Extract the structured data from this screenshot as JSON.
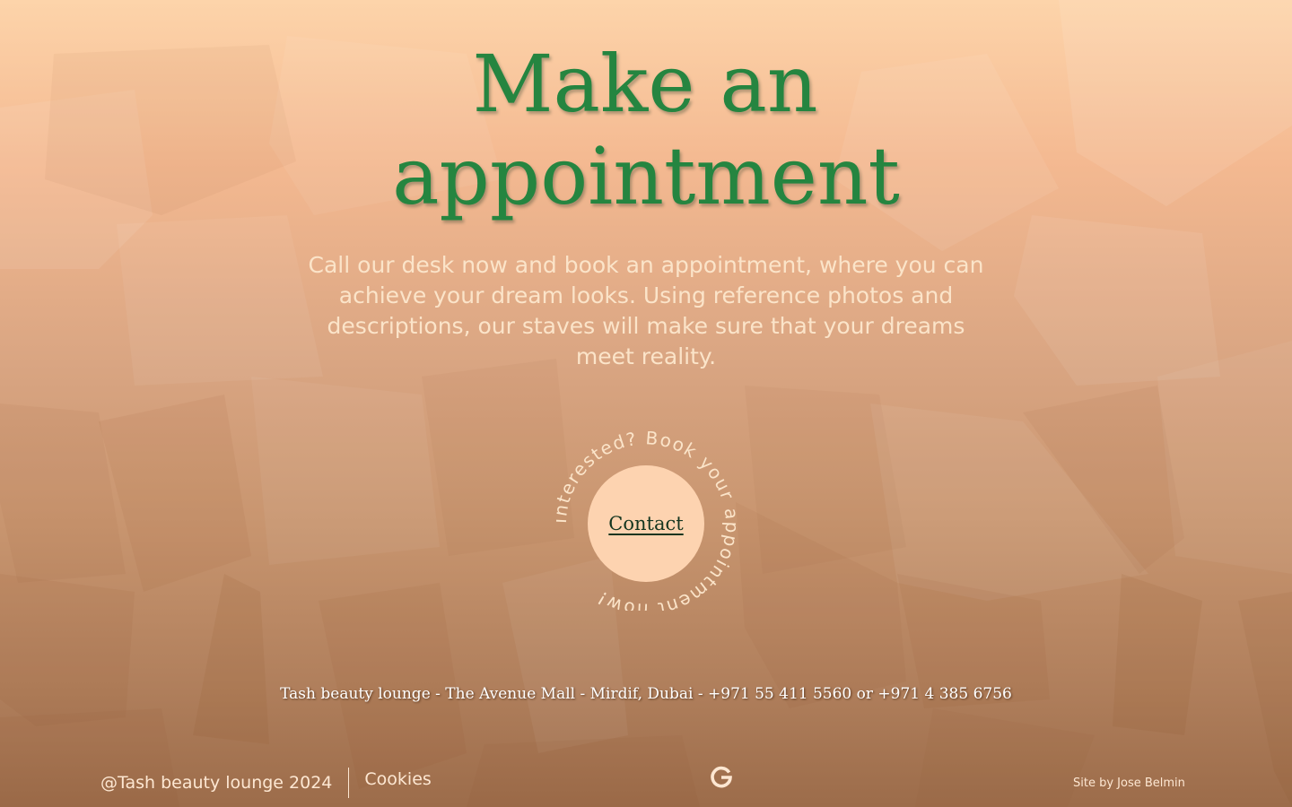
{
  "hero": {
    "title_line1": "Make an",
    "title_line2": "appointment",
    "description": "Call our desk now and book an appointment, where you can achieve your dream looks. Using reference photos and descriptions, our staves will make sure that your dreams meet reality."
  },
  "cta": {
    "circular_text": "Interested? Book your appointment now!",
    "button_label": "Contact"
  },
  "address": "Tash beauty lounge - The Avenue Mall - Mirdif, Dubai - +971 55 411 5560 or +971 4 385 6756",
  "footer": {
    "copyright": "@Tash beauty lounge 2024",
    "cookies_label": "Cookies",
    "google_icon": "google-icon",
    "site_by": "Site by Jose Belmin"
  },
  "colors": {
    "title_green": "#258540",
    "description_text": "#fbe4c9",
    "button_bg": "#fdd3b0",
    "footer_text": "#fde7d2"
  }
}
